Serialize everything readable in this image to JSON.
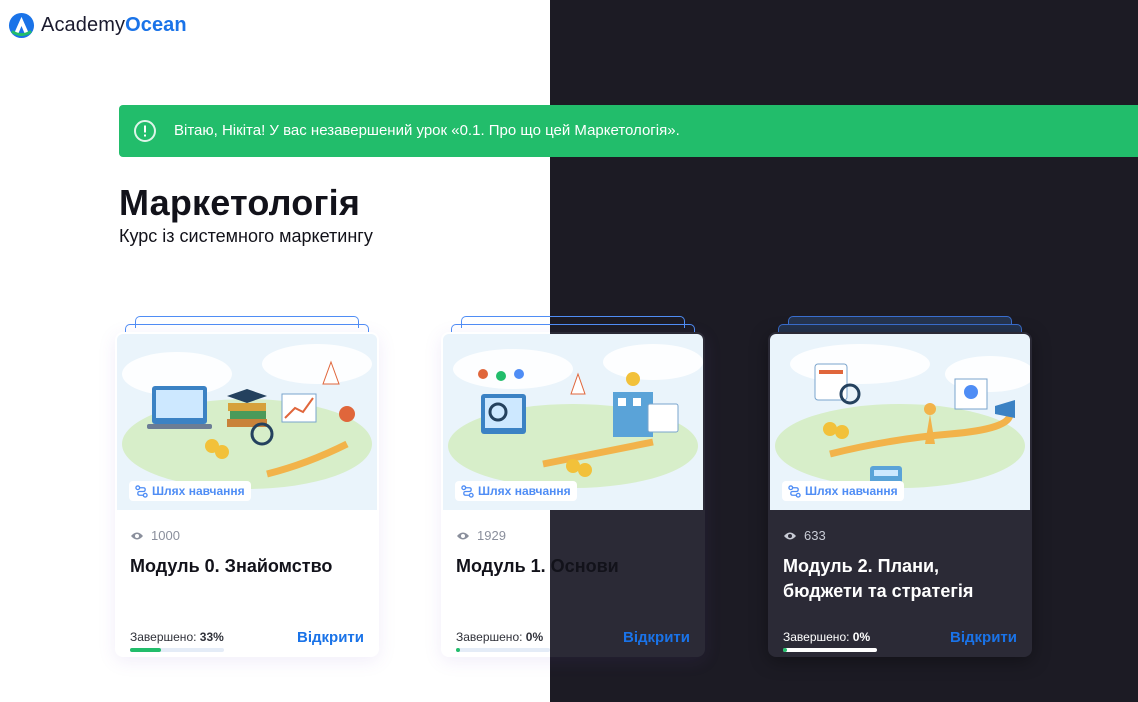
{
  "logo": {
    "text_regular": "Academy",
    "text_bold": "Ocean"
  },
  "banner": {
    "message": "Вітаю, Нікіта! У вас незавершений урок «0.1. Про що цей Маркетологія»."
  },
  "course": {
    "title": "Маркетологія",
    "subtitle": "Курс із системного маркетингу"
  },
  "colors": {
    "accent": "#1a73e8",
    "success": "#22bd6b",
    "dark_bg": "#1c1b24",
    "card_dark": "#2b2a36"
  },
  "modules": [
    {
      "badge": "Шлях навчання",
      "views": "1000",
      "title": "Модуль 0. Знайомство",
      "completed_label": "Завершено:",
      "completed_value": "33%",
      "progress": 0.33,
      "open_label": "Відкрити"
    },
    {
      "badge": "Шлях навчання",
      "views": "1929",
      "title": "Модуль 1. Основи",
      "completed_label": "Завершено:",
      "completed_value": "0%",
      "progress": 0.0,
      "open_label": "Відкрити"
    },
    {
      "badge": "Шлях навчання",
      "views": "633",
      "title": "Модуль 2. Плани, бюджети та стратегія",
      "completed_label": "Завершено:",
      "completed_value": "0%",
      "progress": 0.0,
      "open_label": "Відкрити"
    }
  ]
}
